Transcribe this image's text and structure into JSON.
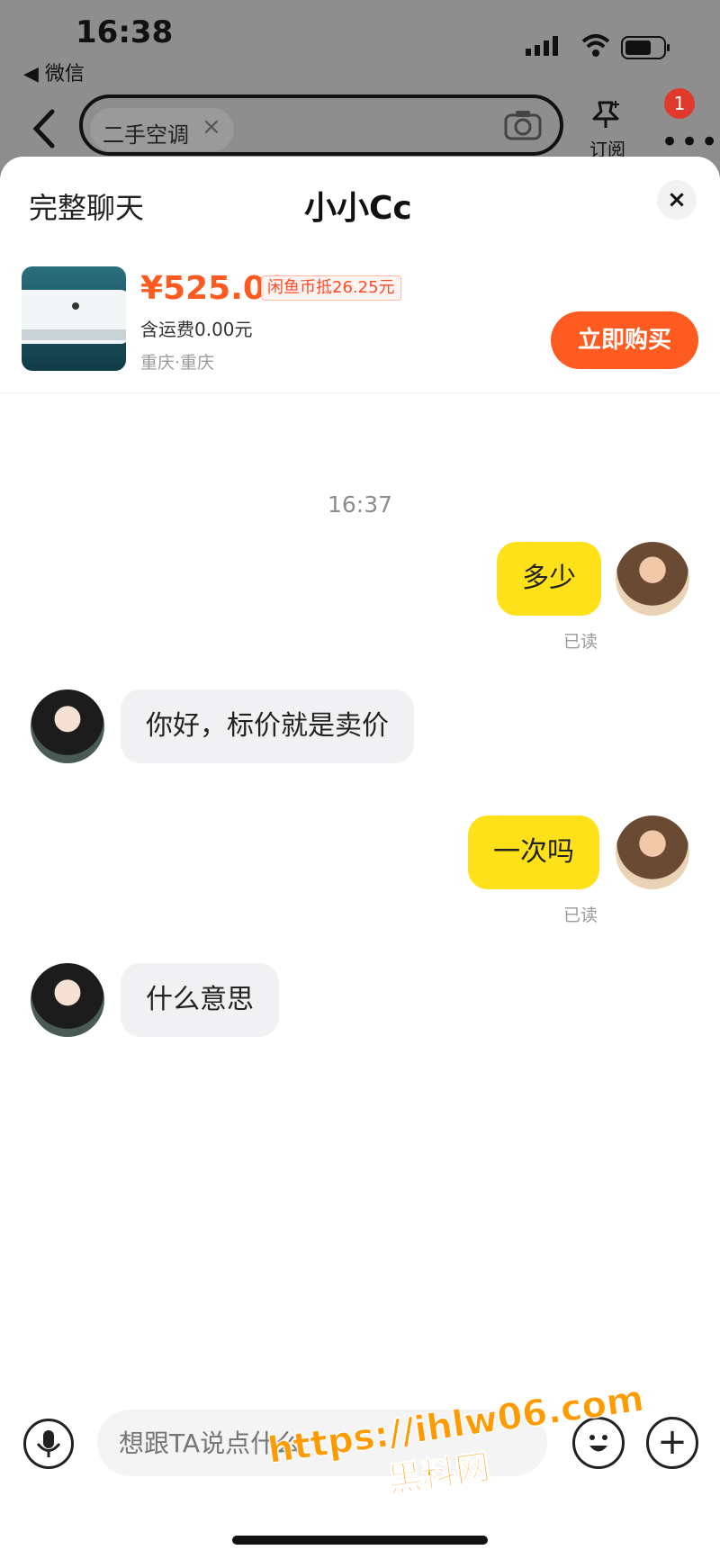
{
  "status_bar": {
    "time": "16:38",
    "back_app": "◀ 微信"
  },
  "nav": {
    "search_chip": "二手空调",
    "chip_clear": "×",
    "subscribe_label": "订阅",
    "notification_count": "1",
    "more": "•••"
  },
  "sheet": {
    "left_label": "完整聊天",
    "title": "小小Cc",
    "close": "×"
  },
  "product": {
    "price": "¥525.00",
    "coin_discount": "闲鱼币抵26.25元",
    "shipping": "含运费0.00元",
    "location": "重庆·重庆",
    "buy_button": "立即购买"
  },
  "chat": {
    "timestamp": "16:37",
    "messages": [
      {
        "from": "me",
        "text": "多少",
        "status": "已读"
      },
      {
        "from": "seller",
        "text": "你好，标价就是卖价"
      },
      {
        "from": "me",
        "text": "一次吗",
        "status": "已读"
      },
      {
        "from": "seller",
        "text": "什么意思"
      }
    ]
  },
  "input_bar": {
    "placeholder": "想跟TA说点什么",
    "plus": "+"
  },
  "watermark": {
    "url": "https://ihlw06.com",
    "name": "黑料网"
  },
  "colors": {
    "accent": "#ff5a1f",
    "my_bubble": "#ffe11a",
    "their_bubble": "#f1f1f3"
  }
}
